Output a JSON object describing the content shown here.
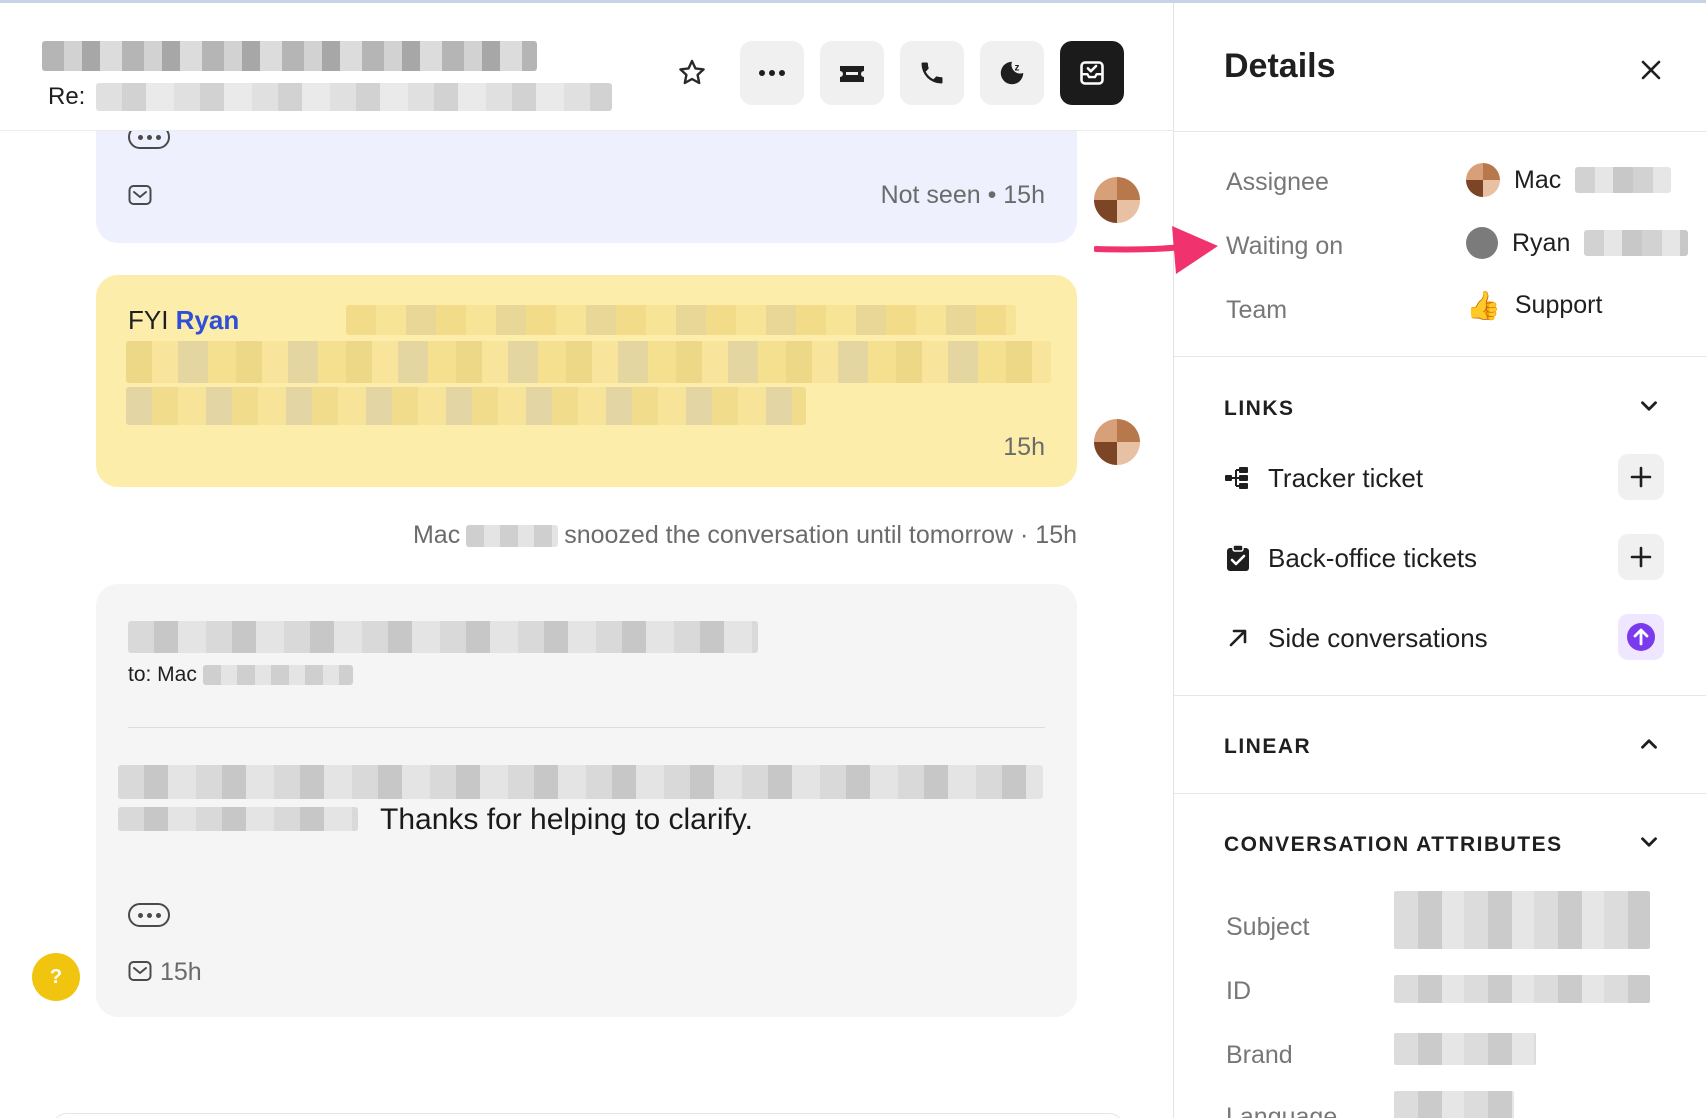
{
  "header": {
    "subject_prefix": "Re: ",
    "star_icon": "star-icon",
    "actions": [
      {
        "name": "more-options-button",
        "icon": "ellipsis-icon"
      },
      {
        "name": "convert-to-ticket-button",
        "icon": "ticket-icon"
      },
      {
        "name": "call-button",
        "icon": "phone-icon"
      },
      {
        "name": "snooze-button",
        "icon": "snooze-moon-icon"
      },
      {
        "name": "close-conversation-button",
        "icon": "inbox-check-icon"
      }
    ]
  },
  "messages": {
    "first": {
      "status": "Not seen • 15h"
    },
    "note": {
      "prefix": "FYI ",
      "mention": "Ryan",
      "time": "15h"
    },
    "system": {
      "actor": "Mac",
      "text": "snoozed the conversation until tomorrow · 15h"
    },
    "email": {
      "to_label": "to: Mac",
      "body_visible": "Thanks for helping to clarify.",
      "time": "15h"
    }
  },
  "help": {
    "label": "?"
  },
  "details": {
    "title": "Details",
    "assignee": {
      "label": "Assignee",
      "value": "Mac"
    },
    "waiting_on": {
      "label": "Waiting on",
      "value": "Ryan"
    },
    "team": {
      "label": "Team",
      "value": "Support",
      "emoji": "👍"
    },
    "links": {
      "heading": "LINKS",
      "items": [
        {
          "label": "Tracker ticket",
          "icon": "tracker-icon",
          "action": "add"
        },
        {
          "label": "Back-office tickets",
          "icon": "clipboard-check-icon",
          "action": "add"
        },
        {
          "label": "Side conversations",
          "icon": "arrow-up-right-icon",
          "action": "upgrade"
        }
      ]
    },
    "linear": {
      "heading": "LINEAR"
    },
    "attributes": {
      "heading": "CONVERSATION ATTRIBUTES",
      "fields": [
        {
          "label": "Subject"
        },
        {
          "label": "ID"
        },
        {
          "label": "Brand"
        },
        {
          "label": "Language"
        }
      ]
    }
  },
  "colors": {
    "accent_mention": "#2f4fd8",
    "note_bg": "#fdedaa",
    "first_bubble_bg": "#eef0fd",
    "annotation_arrow": "#f0336e",
    "upgrade_purple": "#7c3aed"
  }
}
